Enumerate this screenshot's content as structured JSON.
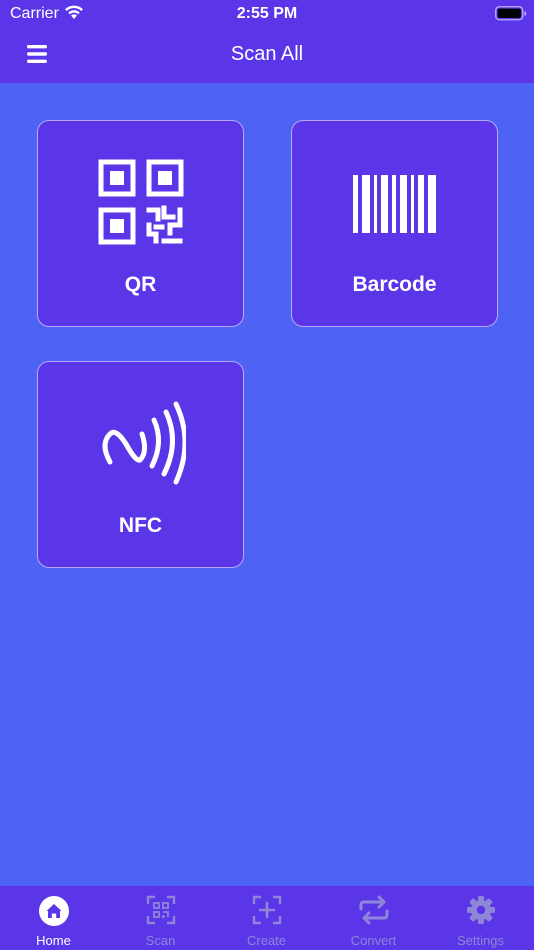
{
  "status_bar": {
    "carrier": "Carrier",
    "time": "2:55 PM"
  },
  "header": {
    "title": "Scan All",
    "menu_icon": "hamburger-menu-icon"
  },
  "tiles": [
    {
      "label": "QR",
      "icon": "qr-code-icon"
    },
    {
      "label": "Barcode",
      "icon": "barcode-icon"
    },
    {
      "label": "NFC",
      "icon": "nfc-icon"
    }
  ],
  "tabbar": {
    "items": [
      {
        "label": "Home",
        "icon": "home-icon",
        "active": true
      },
      {
        "label": "Scan",
        "icon": "scan-icon",
        "active": false
      },
      {
        "label": "Create",
        "icon": "create-icon",
        "active": false
      },
      {
        "label": "Convert",
        "icon": "convert-icon",
        "active": false
      },
      {
        "label": "Settings",
        "icon": "gear-icon",
        "active": false
      }
    ]
  },
  "colors": {
    "background": "#4e63f3",
    "bar": "#5b35e8",
    "tile_border": "#b6aaf5",
    "inactive_tab": "#8f86d8"
  }
}
